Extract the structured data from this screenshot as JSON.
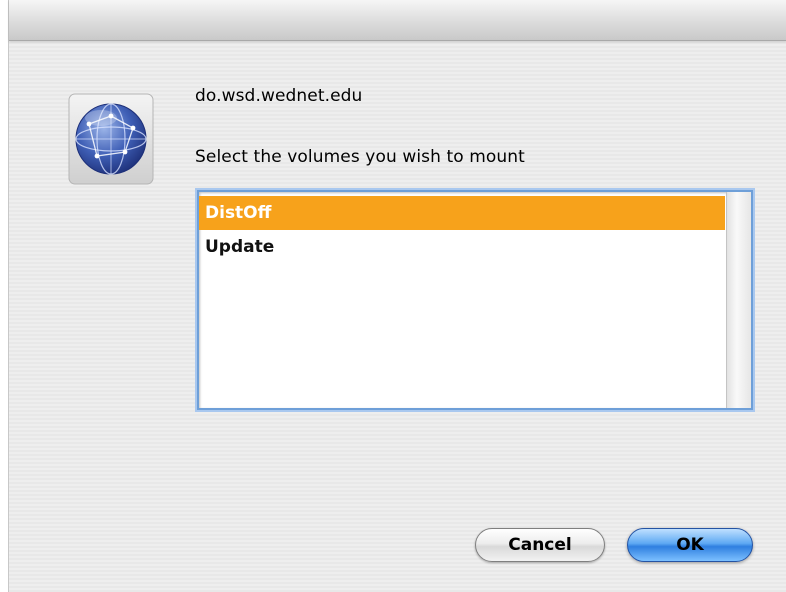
{
  "dialog": {
    "server_name": "do.wsd.wednet.edu",
    "prompt": "Select the volumes you wish to mount",
    "icon": "network-globe-icon"
  },
  "volumes": {
    "items": [
      {
        "label": "DistOff",
        "selected": true
      },
      {
        "label": "Update",
        "selected": false
      }
    ]
  },
  "buttons": {
    "cancel_label": "Cancel",
    "ok_label": "OK"
  },
  "colors": {
    "selection": "#f7a21b",
    "default_button": "#3a88e6",
    "focus_ring": "#6e9fd8"
  }
}
